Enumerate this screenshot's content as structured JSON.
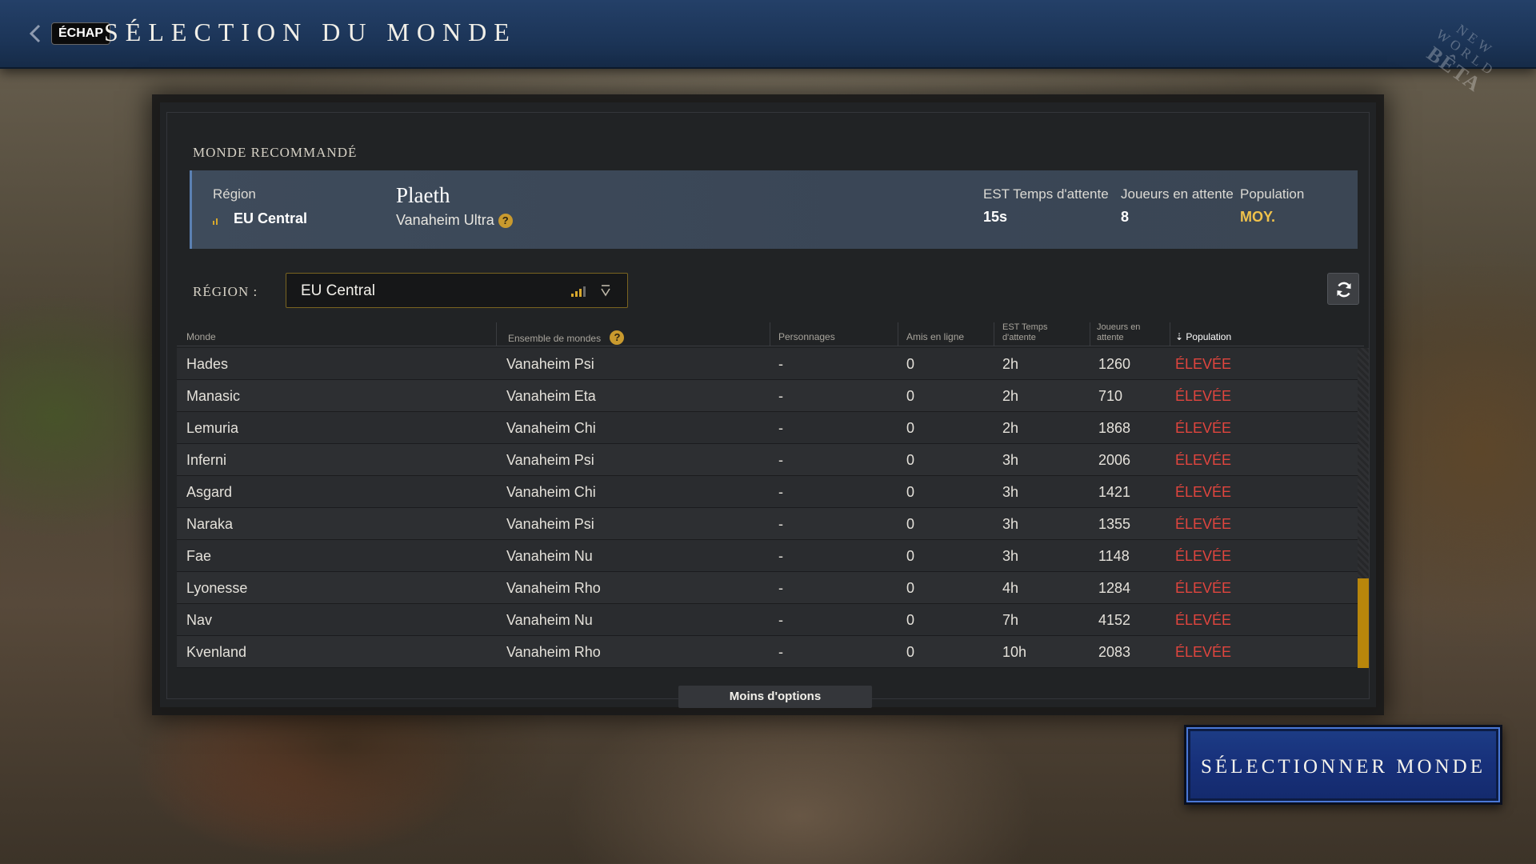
{
  "header": {
    "back_key": "ÉCHAP",
    "title": "SÉLECTION DU MONDE",
    "logo_line1": "NEW WORLD",
    "logo_line2": "BÊTA"
  },
  "recommended": {
    "heading": "MONDE RECOMMANDÉ",
    "region_label": "Région",
    "region_value": "EU Central",
    "world_name": "Plaeth",
    "world_set": "Vanaheim Ultra",
    "wait_label": "EST Temps d'attente",
    "wait_value": "15s",
    "queue_label": "Joueurs en attente",
    "queue_value": "8",
    "population_label": "Population",
    "population_value": "MOY."
  },
  "region_filter": {
    "label": "RÉGION :",
    "selected": "EU Central"
  },
  "table": {
    "headers": {
      "world": "Monde",
      "world_set": "Ensemble de mondes",
      "characters": "Personnages",
      "friends": "Amis en ligne",
      "wait_l1": "EST Temps",
      "wait_l2": "d'attente",
      "queue_l1": "Joueurs en",
      "queue_l2": "attente",
      "population": "Population"
    },
    "rows": [
      {
        "world": "Hades",
        "set": "Vanaheim Psi",
        "chars": "-",
        "friends": "0",
        "wait": "2h",
        "queue": "1260",
        "pop": "ÉLEVÉE"
      },
      {
        "world": "Manasic",
        "set": "Vanaheim Eta",
        "chars": "-",
        "friends": "0",
        "wait": "2h",
        "queue": "710",
        "pop": "ÉLEVÉE"
      },
      {
        "world": "Lemuria",
        "set": "Vanaheim Chi",
        "chars": "-",
        "friends": "0",
        "wait": "2h",
        "queue": "1868",
        "pop": "ÉLEVÉE"
      },
      {
        "world": "Inferni",
        "set": "Vanaheim Psi",
        "chars": "-",
        "friends": "0",
        "wait": "3h",
        "queue": "2006",
        "pop": "ÉLEVÉE"
      },
      {
        "world": "Asgard",
        "set": "Vanaheim Chi",
        "chars": "-",
        "friends": "0",
        "wait": "3h",
        "queue": "1421",
        "pop": "ÉLEVÉE"
      },
      {
        "world": "Naraka",
        "set": "Vanaheim Psi",
        "chars": "-",
        "friends": "0",
        "wait": "3h",
        "queue": "1355",
        "pop": "ÉLEVÉE"
      },
      {
        "world": "Fae",
        "set": "Vanaheim Nu",
        "chars": "-",
        "friends": "0",
        "wait": "3h",
        "queue": "1148",
        "pop": "ÉLEVÉE"
      },
      {
        "world": "Lyonesse",
        "set": "Vanaheim Rho",
        "chars": "-",
        "friends": "0",
        "wait": "4h",
        "queue": "1284",
        "pop": "ÉLEVÉE"
      },
      {
        "world": "Nav",
        "set": "Vanaheim Nu",
        "chars": "-",
        "friends": "0",
        "wait": "7h",
        "queue": "4152",
        "pop": "ÉLEVÉE"
      },
      {
        "world": "Kvenland",
        "set": "Vanaheim Rho",
        "chars": "-",
        "friends": "0",
        "wait": "10h",
        "queue": "2083",
        "pop": "ÉLEVÉE"
      }
    ]
  },
  "less_options": "Moins d'options",
  "select_button": "SÉLECTIONNER MONDE",
  "colors": {
    "accent_gold": "#c99a2e",
    "population_high": "#e0453e",
    "population_medium": "#f0c24b",
    "primary_blue": "#1d3d86"
  },
  "icons": [
    "chevron-left-icon",
    "help-icon",
    "signal-icon",
    "chevron-down-icon",
    "refresh-icon",
    "sort-icon"
  ]
}
